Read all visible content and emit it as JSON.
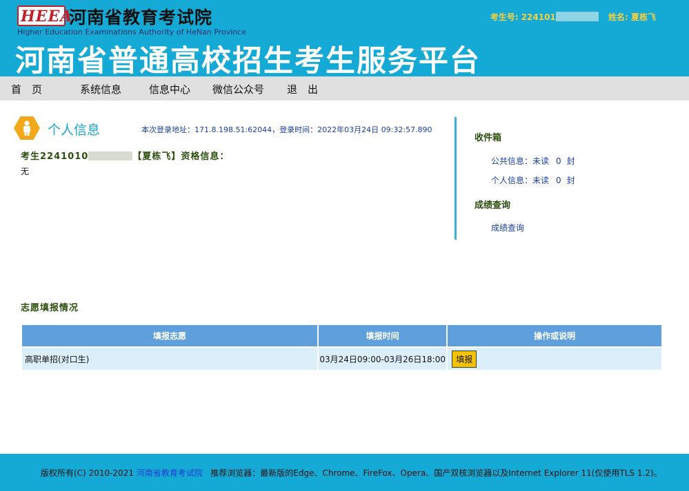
{
  "header": {
    "logo_text": "HEEA",
    "org_name": "河南省教育考试院",
    "org_name_en": "Higher Education Examinations Authority of HeNan Province",
    "platform_title": "河南省普通高校招生考生服务平台",
    "exam_id_label": "考生号:",
    "exam_id_visible": "224101",
    "name_label": "姓名:",
    "name_value": "夏栋飞"
  },
  "nav": {
    "items": [
      "首　页",
      "系统信息",
      "信息中心",
      "微信公众号",
      "退　出"
    ]
  },
  "personal": {
    "title": "个人信息",
    "login_info": "本次登录地址：171.8.198.51:62044，登录时间：2022年03月24日 09:32:57.890",
    "qual_prefix": "考生2241010",
    "qual_suffix": "【夏栋飞】资格信息：",
    "qual_value": "无"
  },
  "inbox": {
    "title": "收件箱",
    "public_label": "公共信息：未读",
    "public_count": "0",
    "public_unit": "封",
    "private_label": "个人信息：未读",
    "private_count": "0",
    "private_unit": "封"
  },
  "scores": {
    "title": "成绩查询",
    "link": "成绩查询"
  },
  "wish": {
    "title": "志愿填报情况",
    "headers": [
      "填报志愿",
      "填报时间",
      "操作或说明"
    ],
    "rows": [
      {
        "name": "高职单招(对口生)",
        "time": "03月24日09:00-03月26日18:00",
        "action": "填报"
      }
    ]
  },
  "footer": {
    "copyright": "版权所有(C) 2010-2021",
    "org_link": "河南省教育考试院",
    "browser_note": "推荐浏览器：最新版的Edge、Chrome、FireFox、Opera、国产双核浏览器以及Internet Explorer 11(仅使用TLS 1.2)。"
  },
  "colors": {
    "header_bg": "#15aad6",
    "nav_bg": "#e0e0e0",
    "accent_yellow": "#f5d042",
    "table_header": "#5e9fdc",
    "table_row": "#dbeffb",
    "button_bg": "#f5c400"
  }
}
